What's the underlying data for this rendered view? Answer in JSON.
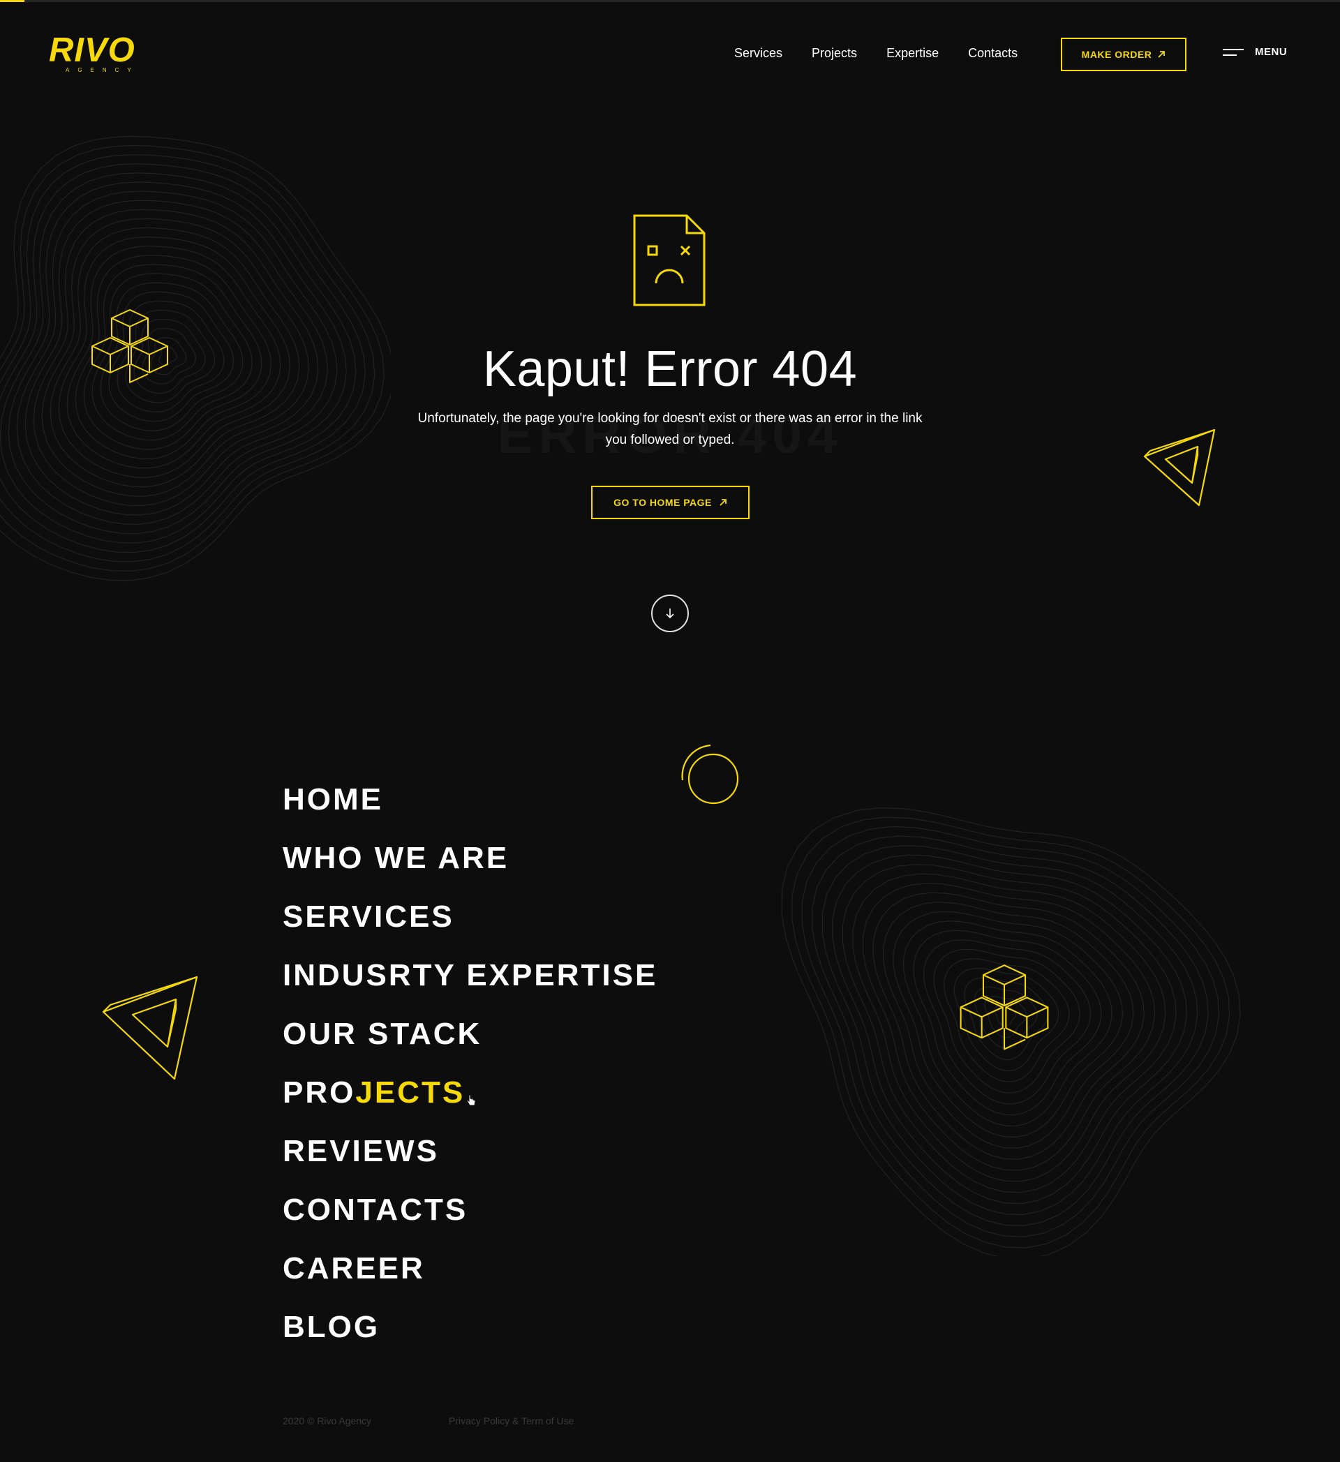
{
  "brand": {
    "logo_text": "RIVO",
    "logo_subtitle": "AGENCY",
    "accent_color": "#f5d90a",
    "background_color": "#0d0d0d"
  },
  "page_progress": {
    "fraction": 0.018
  },
  "header": {
    "nav": [
      "Services",
      "Projects",
      "Expertise",
      "Contacts"
    ],
    "cta_label": "MAKE ORDER",
    "cta_icon": "arrow-up-right-icon",
    "menu_label": "MENU",
    "menu_icon": "hamburger-icon"
  },
  "hero": {
    "icon": "sad-document-icon",
    "title": "Kaput! Error 404",
    "ghost_text": "ERROR 404",
    "description": "Unfortunately, the page you're looking for doesn't exist or there was an error in the link you followed or typed.",
    "button_label": "GO TO HOME PAGE",
    "button_icon": "arrow-up-right-icon",
    "scroll_icon": "arrow-down-icon"
  },
  "menu": {
    "items": [
      "HOME",
      "WHO WE ARE",
      "SERVICES",
      "INDUSRTY EXPERTISE",
      "OUR STACK",
      "PROJECTS",
      "REVIEWS",
      "CONTACTS",
      "CAREER",
      "BLOG"
    ],
    "hover_item": {
      "normal_part": "PRO",
      "highlight_part": "JECTS"
    }
  },
  "footer": {
    "copyright": "2020 © Rivo Agency",
    "legal": "Privacy Policy & Term of Use"
  }
}
